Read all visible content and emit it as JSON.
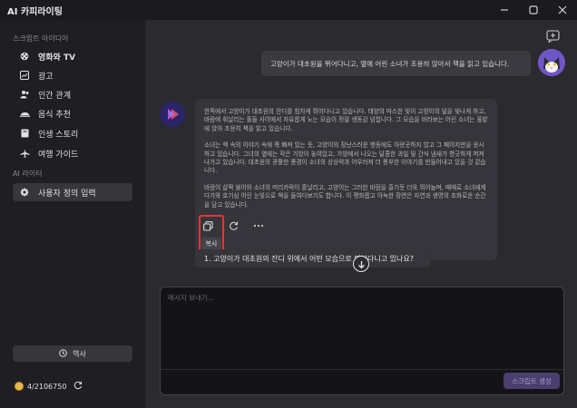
{
  "app": {
    "title": "AI 카피라이팅"
  },
  "window": {
    "minimize_icon": "minimize-icon",
    "maximize_icon": "maximize-icon",
    "close_icon": "close-icon"
  },
  "sidebar": {
    "section1_label": "스크립트 아이디어",
    "items": [
      {
        "label": "영화와 TV",
        "icon": "film-reel-icon"
      },
      {
        "label": "광고",
        "icon": "chart-icon"
      },
      {
        "label": "인간 관계",
        "icon": "people-icon"
      },
      {
        "label": "음식 추천",
        "icon": "dish-icon"
      },
      {
        "label": "인생 스토리",
        "icon": "book-icon"
      },
      {
        "label": "여행 가이드",
        "icon": "airplane-icon"
      }
    ],
    "section2_label": "AI 라이터",
    "custom_item": {
      "label": "사용자 정의 입력",
      "icon": "gear-icon"
    },
    "history_label": "역사",
    "credits": "4/2106750"
  },
  "chat": {
    "user_message": "고양이가 대초원을 뛰어다니고, 옆에 어린 소녀가 조용히 앉아서 책을 읽고 있습니다.",
    "ai_paragraphs": [
      "한쪽에서 고양이가 대초원의 잔디를 힘차게 뛰어다니고 있습니다. 태양의 따스한 빛이 고양이의 털을 빛나게 하고, 바람에 휘날리는 풀들 사이에서 자유롭게 노는 모습이 정말 생동감 넘칩니다. 그 모습을 바라보는 어린 소녀는 풀밭에 앉아 조용히 책을 읽고 있습니다.",
      "소녀는 책 속의 이야기 속에 푹 빠져 있는 듯, 고양이의 장난스러운 행동에도 아랑곳하지 않고 그 페이지만을 응시하고 있습니다. 그녀의 옆에는 작은 가방이 놓여있고, 가방에서 나오는 달콤한 과일 및 간식 냄새가 향긋하게 퍼져나가고 있습니다. 대초원의 광활한 풍경이 소녀의 상상력과 어우러져 더 풍부한 이야기를 만들어내고 있을 것 같습니다.",
      "바람이 살짝 불어와 소녀의 머리카락이 흩날리고, 고양이는 그러한 바람을 즐기듯 더욱 뛰어놀며, 때때로 소녀에게 다가와 호기심 어린 눈빛으로 책을 들여다보기도 합니다. 이 평화롭고 아늑한 장면은 자연과 생명의 조화로운 순간을 담고 있습니다."
    ],
    "copy_tooltip": "복사",
    "suggestion": "1. 고양이가 대초원의 잔디 위에서 어떤 모습으로 뛰어다니고 있나요?",
    "input_placeholder": "메시지 보내기...",
    "send_label": "스크립트 생성"
  },
  "colors": {
    "accent": "#6e56c7",
    "highlight": "#e0373a",
    "coin": "#e8b64a"
  }
}
